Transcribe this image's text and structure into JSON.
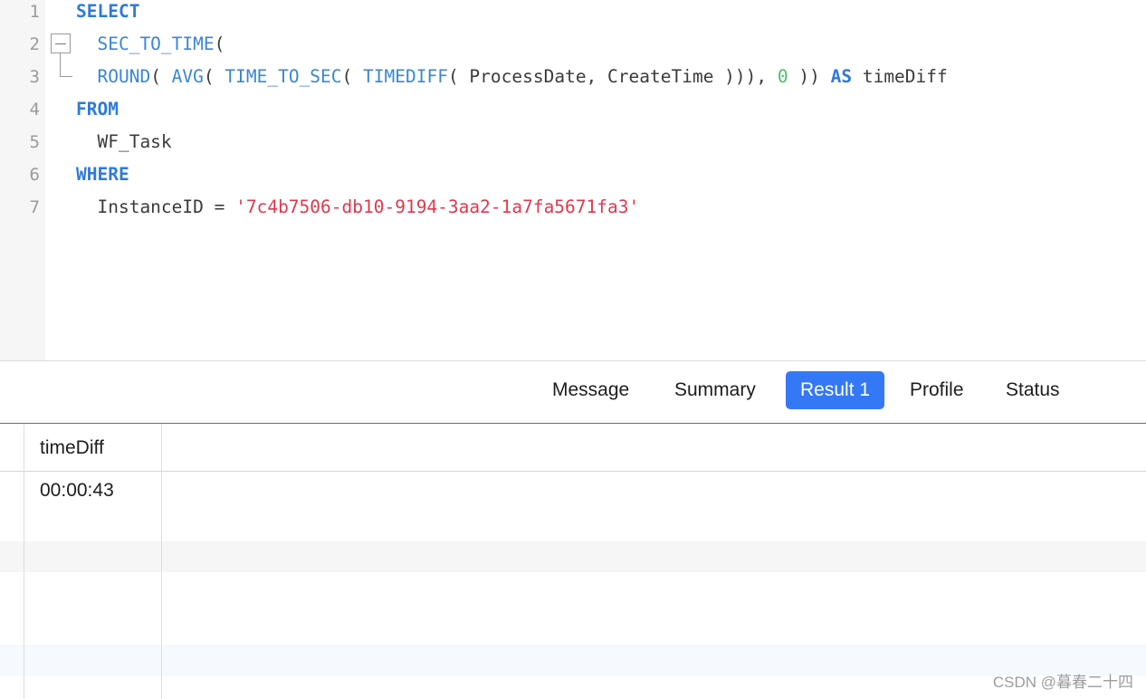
{
  "editor": {
    "line_numbers": [
      "1",
      "2",
      "3",
      "4",
      "5",
      "6",
      "7"
    ],
    "lines": [
      [
        {
          "t": "SELECT",
          "c": "kw"
        }
      ],
      [
        {
          "t": "  ",
          "c": ""
        },
        {
          "t": "SEC_TO_TIME",
          "c": "fn"
        },
        {
          "t": "(",
          "c": ""
        }
      ],
      [
        {
          "t": "  ",
          "c": ""
        },
        {
          "t": "ROUND",
          "c": "fn"
        },
        {
          "t": "( ",
          "c": ""
        },
        {
          "t": "AVG",
          "c": "fn"
        },
        {
          "t": "( ",
          "c": ""
        },
        {
          "t": "TIME_TO_SEC",
          "c": "fn"
        },
        {
          "t": "( ",
          "c": ""
        },
        {
          "t": "TIMEDIFF",
          "c": "fn"
        },
        {
          "t": "( ProcessDate, CreateTime ))), ",
          "c": ""
        },
        {
          "t": "0",
          "c": "num"
        },
        {
          "t": " )) ",
          "c": ""
        },
        {
          "t": "AS",
          "c": "kw"
        },
        {
          "t": " timeDiff",
          "c": ""
        }
      ],
      [
        {
          "t": "FROM",
          "c": "kw"
        }
      ],
      [
        {
          "t": "  WF_Task",
          "c": ""
        }
      ],
      [
        {
          "t": "WHERE",
          "c": "kw"
        }
      ],
      [
        {
          "t": "  InstanceID = ",
          "c": ""
        },
        {
          "t": "'7c4b7506-db10-9194-3aa2-1a7fa5671fa3'",
          "c": "str"
        }
      ]
    ]
  },
  "tabs": [
    {
      "label": "Message",
      "active": false
    },
    {
      "label": "Summary",
      "active": false
    },
    {
      "label": "Result 1",
      "active": true
    },
    {
      "label": "Profile",
      "active": false
    },
    {
      "label": "Status",
      "active": false
    }
  ],
  "results": {
    "columns": [
      "timeDiff"
    ],
    "rows": [
      [
        "00:00:43"
      ]
    ]
  },
  "watermark": "CSDN @暮春二十四",
  "colors": {
    "keyword": "#2f7ad8",
    "function": "#3a86d6",
    "number": "#4fbf6d",
    "string": "#e0384d",
    "active_tab": "#3478f6"
  }
}
